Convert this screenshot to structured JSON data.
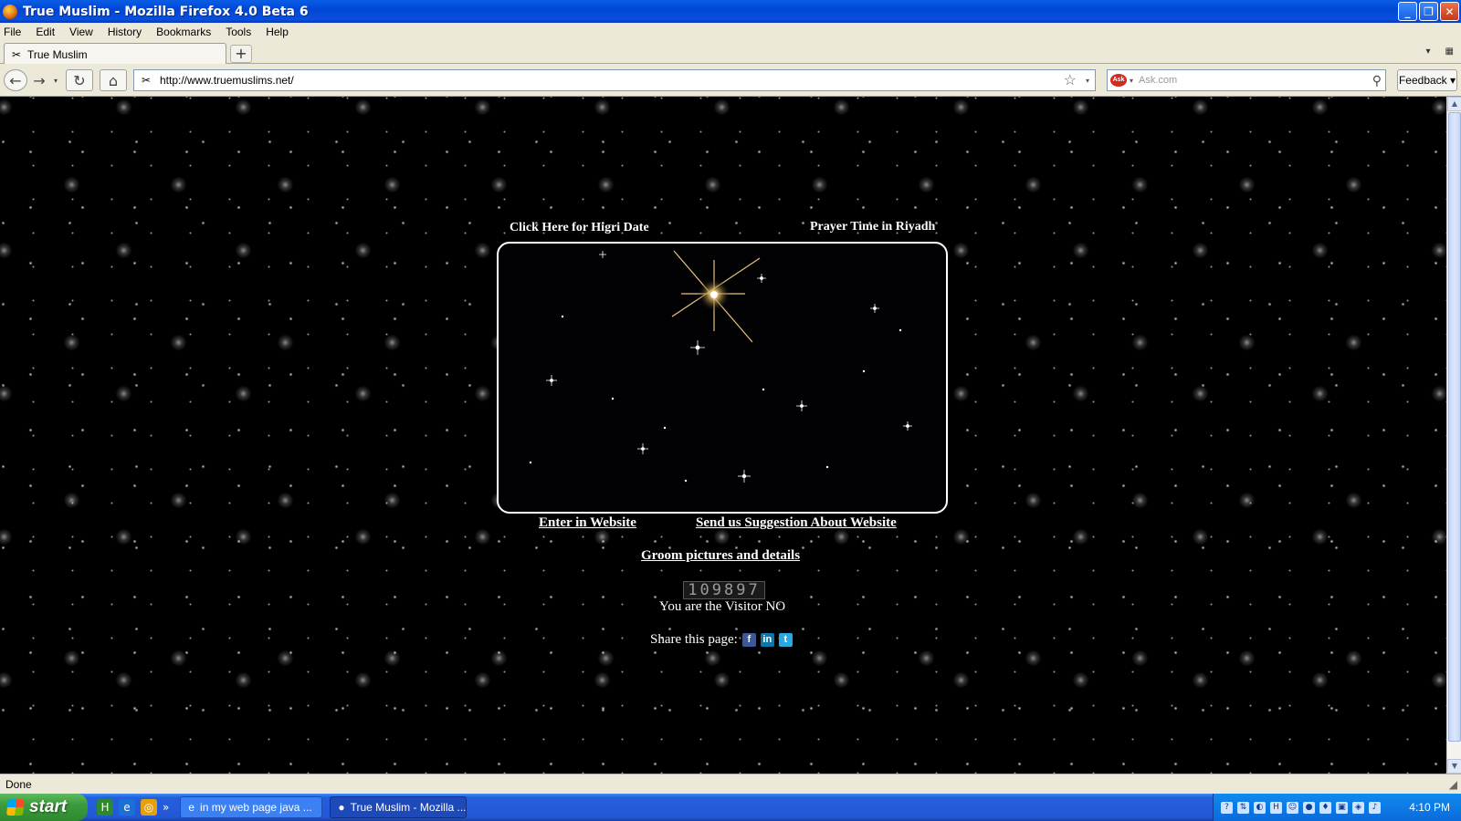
{
  "window": {
    "title": "True Muslim - Mozilla Firefox 4.0 Beta 6"
  },
  "menu": [
    "File",
    "Edit",
    "View",
    "History",
    "Bookmarks",
    "Tools",
    "Help"
  ],
  "tab": {
    "label": "True Muslim"
  },
  "nav": {
    "url": "http://www.truemuslims.net/",
    "search_placeholder": "Ask.com",
    "feedback_label": "Feedback"
  },
  "page": {
    "higri_link": "Click Here for Higri Date",
    "prayer_link": "Prayer Time in Riyadh",
    "enter_link": "Enter in Website",
    "suggestion_link": "Send us Suggestion About Website",
    "groom_link": "Groom pictures and details",
    "visitor_count": "109897",
    "visitor_text": "You are the Visitor NO",
    "share_label": "Share this page:"
  },
  "status": {
    "text": "Done"
  },
  "taskbar": {
    "start_label": "start",
    "tasks": [
      {
        "label": "in my web page java ..."
      },
      {
        "label": "True Muslim - Mozilla ..."
      }
    ],
    "clock": "4:10 PM"
  },
  "colors": {
    "titlebar": "#0046d5",
    "chrome": "#ece9d8",
    "taskbar": "#245edb",
    "page_bg": "#000000"
  }
}
